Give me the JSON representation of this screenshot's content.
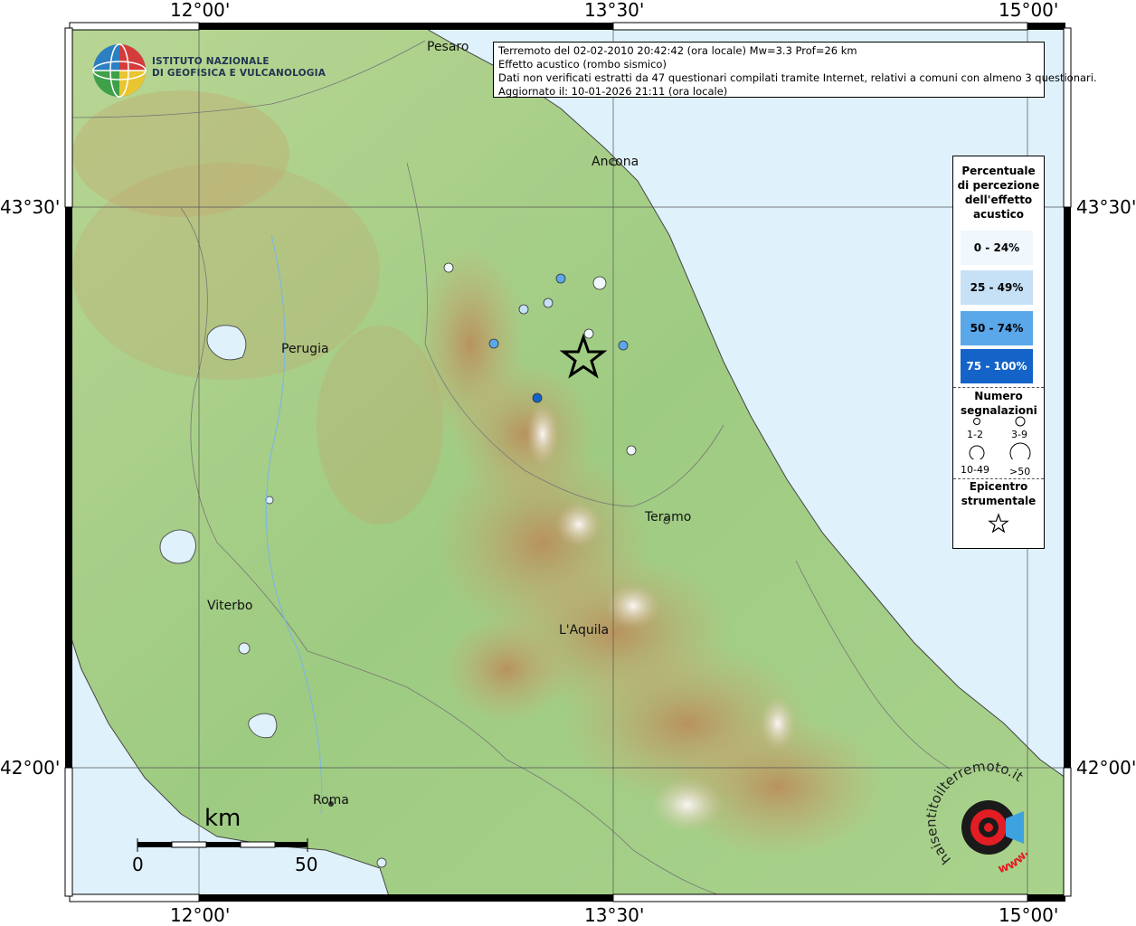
{
  "axes": {
    "lon_ticks": [
      "12°00'",
      "13°30'",
      "15°00'"
    ],
    "lat_ticks": [
      "43°30'",
      "42°00'"
    ]
  },
  "info": {
    "line1": "Terremoto del 02-02-2010 20:42:42 (ora locale) Mw=3.3 Prof=26 km",
    "line2": "Effetto acustico (rombo sismico)",
    "line3": "Dati non verificati estratti da 47 questionari compilati tramite Internet, relativi a comuni con almeno 3 questionari.",
    "line4": "Aggiornato il: 10-01-2026 21:11 (ora locale)"
  },
  "logo": {
    "line1": "ISTITUTO NAZIONALE",
    "line2": "DI GEOFISICA E VULCANOLOGIA"
  },
  "cities": [
    "Pesaro",
    "Ancona",
    "Perugia",
    "Teramo",
    "Viterbo",
    "L'Aquila",
    "Roma"
  ],
  "legend": {
    "title": "Percentuale di percezione dell'effetto acustico",
    "classes": [
      {
        "label": "0 - 24%",
        "color": "#f0f7fd"
      },
      {
        "label": "25 - 49%",
        "color": "#c6e0f6"
      },
      {
        "label": "50 - 74%",
        "color": "#5aa7ea"
      },
      {
        "label": "75 - 100%",
        "color": "#1463c8"
      }
    ],
    "count_title": "Numero segnalazioni",
    "count_classes": [
      "1-2",
      "3-9",
      "10-49",
      ">50"
    ],
    "epicenter_title": "Epicentro strumentale"
  },
  "scale": {
    "unit": "km",
    "min": "0",
    "max": "50"
  },
  "watermark": {
    "text": "haisentitoilterremoto.it",
    "prefix": "www."
  },
  "colors": {
    "sea": "#dff1fb",
    "land_low": "#a9d07f",
    "mountain": "#c6a06a",
    "peak": "#f4f0ef"
  }
}
